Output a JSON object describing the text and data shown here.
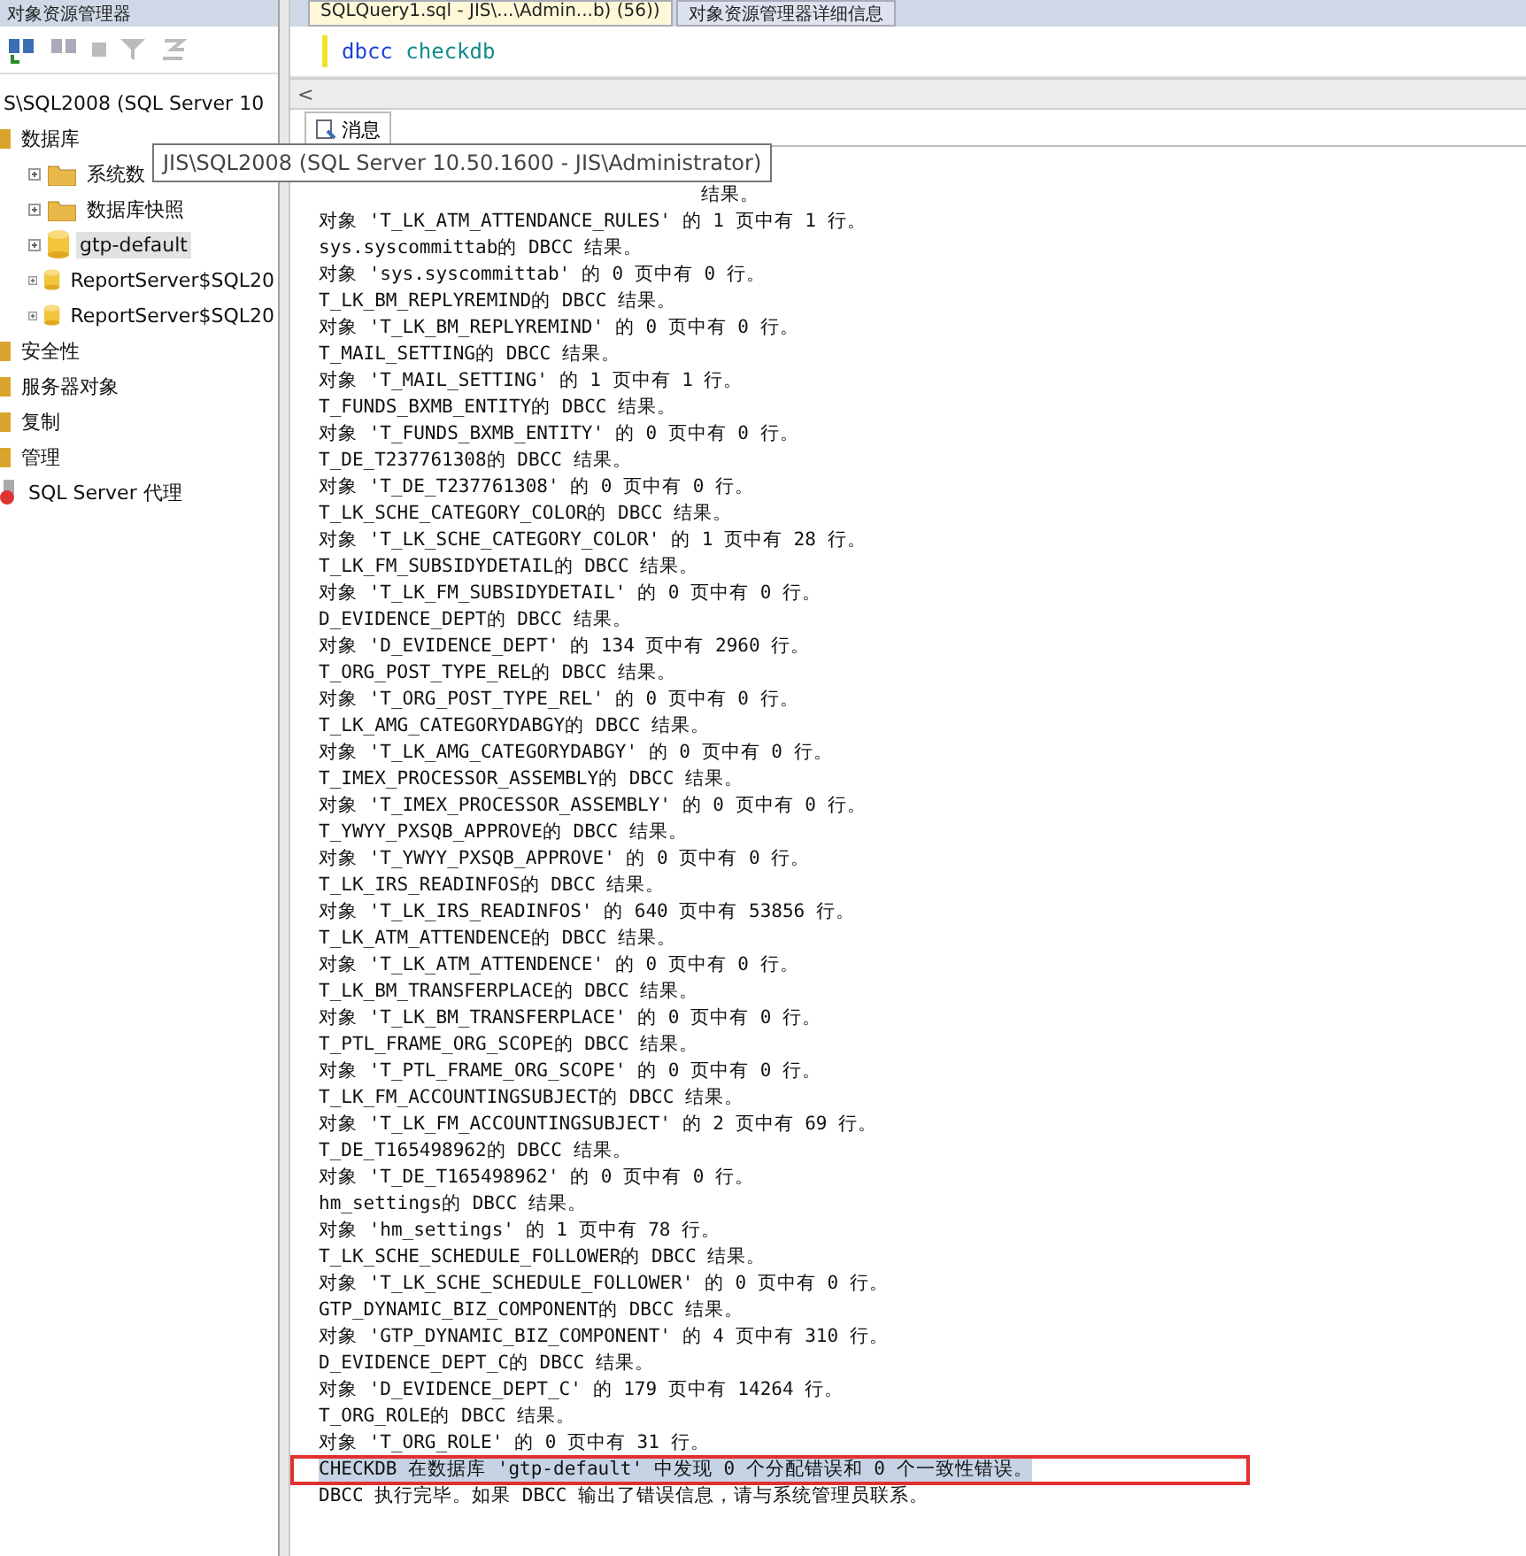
{
  "explorer": {
    "title": "对象资源管理器",
    "server": "S\\SQL2008 (SQL Server 10",
    "tree": [
      {
        "label": "数据库",
        "kind": "folder-small",
        "selected": false,
        "children": [
          {
            "label": "系统数",
            "kind": "folder",
            "selected": false
          },
          {
            "label": "数据库快照",
            "kind": "folder",
            "selected": false
          },
          {
            "label": "gtp-default",
            "kind": "database",
            "selected": true
          },
          {
            "label": "ReportServer$SQL20",
            "kind": "database",
            "selected": false
          },
          {
            "label": "ReportServer$SQL20",
            "kind": "database",
            "selected": false
          }
        ]
      },
      {
        "label": "安全性",
        "kind": "folder-small",
        "selected": false
      },
      {
        "label": "服务器对象",
        "kind": "folder-small",
        "selected": false
      },
      {
        "label": "复制",
        "kind": "folder-small",
        "selected": false
      },
      {
        "label": "管理",
        "kind": "folder-small",
        "selected": false
      },
      {
        "label": "SQL Server 代理",
        "kind": "agent",
        "selected": false
      }
    ]
  },
  "tooltip": "JIS\\SQL2008 (SQL Server 10.50.1600 - JIS\\Administrator)",
  "document_tabs": [
    {
      "label": "SQLQuery1.sql - JIS\\...\\Admin...b) (56))",
      "selected": true
    },
    {
      "label": "对象资源管理器详细信息",
      "selected": false
    }
  ],
  "editor": {
    "keyword": "dbcc",
    "command": "checkdb",
    "scroll_left": "<"
  },
  "results_tab": {
    "label": "消息"
  },
  "messages": [
    {
      "text": "结果。",
      "kind": "tail",
      "selected": false,
      "outlined": false
    },
    {
      "text": "对象 'T_LK_ATM_ATTENDANCE_RULES' 的 1 页中有 1 行。",
      "kind": "line",
      "selected": false,
      "outlined": false
    },
    {
      "text": "sys.syscommittab的 DBCC 结果。",
      "kind": "line",
      "selected": false,
      "outlined": false
    },
    {
      "text": "对象 'sys.syscommittab' 的 0 页中有 0 行。",
      "kind": "line",
      "selected": false,
      "outlined": false
    },
    {
      "text": "T_LK_BM_REPLYREMIND的 DBCC 结果。",
      "kind": "line",
      "selected": false,
      "outlined": false
    },
    {
      "text": "对象 'T_LK_BM_REPLYREMIND' 的 0 页中有 0 行。",
      "kind": "line",
      "selected": false,
      "outlined": false
    },
    {
      "text": "T_MAIL_SETTING的 DBCC 结果。",
      "kind": "line",
      "selected": false,
      "outlined": false
    },
    {
      "text": "对象 'T_MAIL_SETTING' 的 1 页中有 1 行。",
      "kind": "line",
      "selected": false,
      "outlined": false
    },
    {
      "text": "T_FUNDS_BXMB_ENTITY的 DBCC 结果。",
      "kind": "line",
      "selected": false,
      "outlined": false
    },
    {
      "text": "对象 'T_FUNDS_BXMB_ENTITY' 的 0 页中有 0 行。",
      "kind": "line",
      "selected": false,
      "outlined": false
    },
    {
      "text": "T_DE_T237761308的 DBCC 结果。",
      "kind": "line",
      "selected": false,
      "outlined": false
    },
    {
      "text": "对象 'T_DE_T237761308' 的 0 页中有 0 行。",
      "kind": "line",
      "selected": false,
      "outlined": false
    },
    {
      "text": "T_LK_SCHE_CATEGORY_COLOR的 DBCC 结果。",
      "kind": "line",
      "selected": false,
      "outlined": false
    },
    {
      "text": "对象 'T_LK_SCHE_CATEGORY_COLOR' 的 1 页中有 28 行。",
      "kind": "line",
      "selected": false,
      "outlined": false
    },
    {
      "text": "T_LK_FM_SUBSIDYDETAIL的 DBCC 结果。",
      "kind": "line",
      "selected": false,
      "outlined": false
    },
    {
      "text": "对象 'T_LK_FM_SUBSIDYDETAIL' 的 0 页中有 0 行。",
      "kind": "line",
      "selected": false,
      "outlined": false
    },
    {
      "text": "D_EVIDENCE_DEPT的 DBCC 结果。",
      "kind": "line",
      "selected": false,
      "outlined": false
    },
    {
      "text": "对象 'D_EVIDENCE_DEPT' 的 134 页中有 2960 行。",
      "kind": "line",
      "selected": false,
      "outlined": false
    },
    {
      "text": "T_ORG_POST_TYPE_REL的 DBCC 结果。",
      "kind": "line",
      "selected": false,
      "outlined": false
    },
    {
      "text": "对象 'T_ORG_POST_TYPE_REL' 的 0 页中有 0 行。",
      "kind": "line",
      "selected": false,
      "outlined": false
    },
    {
      "text": "T_LK_AMG_CATEGORYDABGY的 DBCC 结果。",
      "kind": "line",
      "selected": false,
      "outlined": false
    },
    {
      "text": "对象 'T_LK_AMG_CATEGORYDABGY' 的 0 页中有 0 行。",
      "kind": "line",
      "selected": false,
      "outlined": false
    },
    {
      "text": "T_IMEX_PROCESSOR_ASSEMBLY的 DBCC 结果。",
      "kind": "line",
      "selected": false,
      "outlined": false
    },
    {
      "text": "对象 'T_IMEX_PROCESSOR_ASSEMBLY' 的 0 页中有 0 行。",
      "kind": "line",
      "selected": false,
      "outlined": false
    },
    {
      "text": "T_YWYY_PXSQB_APPROVE的 DBCC 结果。",
      "kind": "line",
      "selected": false,
      "outlined": false
    },
    {
      "text": "对象 'T_YWYY_PXSQB_APPROVE' 的 0 页中有 0 行。",
      "kind": "line",
      "selected": false,
      "outlined": false
    },
    {
      "text": "T_LK_IRS_READINFOS的 DBCC 结果。",
      "kind": "line",
      "selected": false,
      "outlined": false
    },
    {
      "text": "对象 'T_LK_IRS_READINFOS' 的 640 页中有 53856 行。",
      "kind": "line",
      "selected": false,
      "outlined": false
    },
    {
      "text": "T_LK_ATM_ATTENDENCE的 DBCC 结果。",
      "kind": "line",
      "selected": false,
      "outlined": false
    },
    {
      "text": "对象 'T_LK_ATM_ATTENDENCE' 的 0 页中有 0 行。",
      "kind": "line",
      "selected": false,
      "outlined": false
    },
    {
      "text": "T_LK_BM_TRANSFERPLACE的 DBCC 结果。",
      "kind": "line",
      "selected": false,
      "outlined": false
    },
    {
      "text": "对象 'T_LK_BM_TRANSFERPLACE' 的 0 页中有 0 行。",
      "kind": "line",
      "selected": false,
      "outlined": false
    },
    {
      "text": "T_PTL_FRAME_ORG_SCOPE的 DBCC 结果。",
      "kind": "line",
      "selected": false,
      "outlined": false
    },
    {
      "text": "对象 'T_PTL_FRAME_ORG_SCOPE' 的 0 页中有 0 行。",
      "kind": "line",
      "selected": false,
      "outlined": false
    },
    {
      "text": "T_LK_FM_ACCOUNTINGSUBJECT的 DBCC 结果。",
      "kind": "line",
      "selected": false,
      "outlined": false
    },
    {
      "text": "对象 'T_LK_FM_ACCOUNTINGSUBJECT' 的 2 页中有 69 行。",
      "kind": "line",
      "selected": false,
      "outlined": false
    },
    {
      "text": "T_DE_T165498962的 DBCC 结果。",
      "kind": "line",
      "selected": false,
      "outlined": false
    },
    {
      "text": "对象 'T_DE_T165498962' 的 0 页中有 0 行。",
      "kind": "line",
      "selected": false,
      "outlined": false
    },
    {
      "text": "hm_settings的 DBCC 结果。",
      "kind": "line",
      "selected": false,
      "outlined": false
    },
    {
      "text": "对象 'hm_settings' 的 1 页中有 78 行。",
      "kind": "line",
      "selected": false,
      "outlined": false
    },
    {
      "text": "T_LK_SCHE_SCHEDULE_FOLLOWER的 DBCC 结果。",
      "kind": "line",
      "selected": false,
      "outlined": false
    },
    {
      "text": "对象 'T_LK_SCHE_SCHEDULE_FOLLOWER' 的 0 页中有 0 行。",
      "kind": "line",
      "selected": false,
      "outlined": false
    },
    {
      "text": "GTP_DYNAMIC_BIZ_COMPONENT的 DBCC 结果。",
      "kind": "line",
      "selected": false,
      "outlined": false
    },
    {
      "text": "对象 'GTP_DYNAMIC_BIZ_COMPONENT' 的 4 页中有 310 行。",
      "kind": "line",
      "selected": false,
      "outlined": false
    },
    {
      "text": "D_EVIDENCE_DEPT_C的 DBCC 结果。",
      "kind": "line",
      "selected": false,
      "outlined": false
    },
    {
      "text": "对象 'D_EVIDENCE_DEPT_C' 的 179 页中有 14264 行。",
      "kind": "line",
      "selected": false,
      "outlined": false
    },
    {
      "text": "T_ORG_ROLE的 DBCC 结果。",
      "kind": "line",
      "selected": false,
      "outlined": false
    },
    {
      "text": "对象 'T_ORG_ROLE' 的 0 页中有 31 行。",
      "kind": "line",
      "selected": false,
      "outlined": false
    },
    {
      "text": "CHECKDB 在数据库 'gtp-default' 中发现 0 个分配错误和 0 个一致性错误。",
      "kind": "line",
      "selected": true,
      "outlined": true
    },
    {
      "text": "DBCC 执行完毕。如果 DBCC 输出了错误信息，请与系统管理员联系。",
      "kind": "line",
      "selected": false,
      "outlined": false
    }
  ]
}
